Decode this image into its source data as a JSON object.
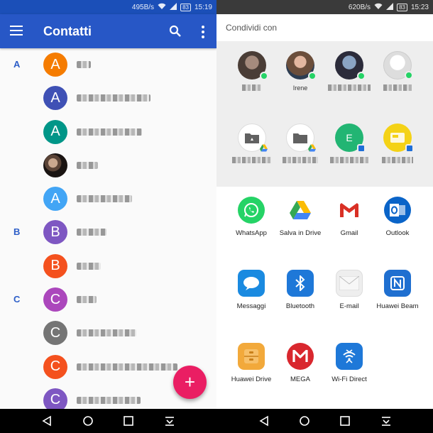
{
  "left": {
    "status": {
      "net_speed": "495B/s",
      "battery": "83",
      "time": "15:19"
    },
    "app_title": "Contatti",
    "sections": [
      "A",
      "B",
      "C"
    ],
    "contacts": [
      {
        "initial": "A",
        "color": "#f57c00"
      },
      {
        "initial": "A",
        "color": "#3f51b5"
      },
      {
        "initial": "A",
        "color": "#009688"
      },
      {
        "initial": "",
        "color": "photo"
      },
      {
        "initial": "A",
        "color": "#42a5f5"
      },
      {
        "initial": "B",
        "color": "#7e57c2"
      },
      {
        "initial": "B",
        "color": "#f4511e"
      },
      {
        "initial": "C",
        "color": "#ab47bc"
      },
      {
        "initial": "C",
        "color": "#757575"
      },
      {
        "initial": "C",
        "color": "#f4511e"
      },
      {
        "initial": "C",
        "color": "#7e57c2"
      }
    ],
    "fab_label": "+"
  },
  "right": {
    "status": {
      "net_speed": "620B/s",
      "battery": "83",
      "time": "15:23"
    },
    "header": "Condividi con",
    "direct_targets": [
      {
        "label": ""
      },
      {
        "label": "Irene"
      },
      {
        "label": ""
      },
      {
        "label": ""
      },
      {
        "label": ""
      },
      {
        "label": ""
      },
      {
        "label": "",
        "letter": "E"
      },
      {
        "label": ""
      }
    ],
    "apps": [
      {
        "label": "WhatsApp",
        "icon": "whatsapp-icon",
        "color": "#25d366"
      },
      {
        "label": "Salva in Drive",
        "icon": "google-drive-icon",
        "color": "#ffffff"
      },
      {
        "label": "Gmail",
        "icon": "gmail-icon",
        "color": "#ffffff"
      },
      {
        "label": "Outlook",
        "icon": "outlook-icon",
        "color": "#0a64c8"
      },
      {
        "label": "Messaggi",
        "icon": "messages-icon",
        "color": "#1a8ae0"
      },
      {
        "label": "Bluetooth",
        "icon": "bluetooth-icon",
        "color": "#1e78d8"
      },
      {
        "label": "E-mail",
        "icon": "email-icon",
        "color": "#eeeeee"
      },
      {
        "label": "Huawei Beam",
        "icon": "nfc-beam-icon",
        "color": "#1f6fd0"
      },
      {
        "label": "Huawei Drive",
        "icon": "huawei-drive-icon",
        "color": "#f2a93b"
      },
      {
        "label": "MEGA",
        "icon": "mega-icon",
        "color": "#d9272e"
      },
      {
        "label": "Wi-Fi Direct",
        "icon": "wifi-direct-icon",
        "color": "#1e78d8"
      }
    ]
  }
}
